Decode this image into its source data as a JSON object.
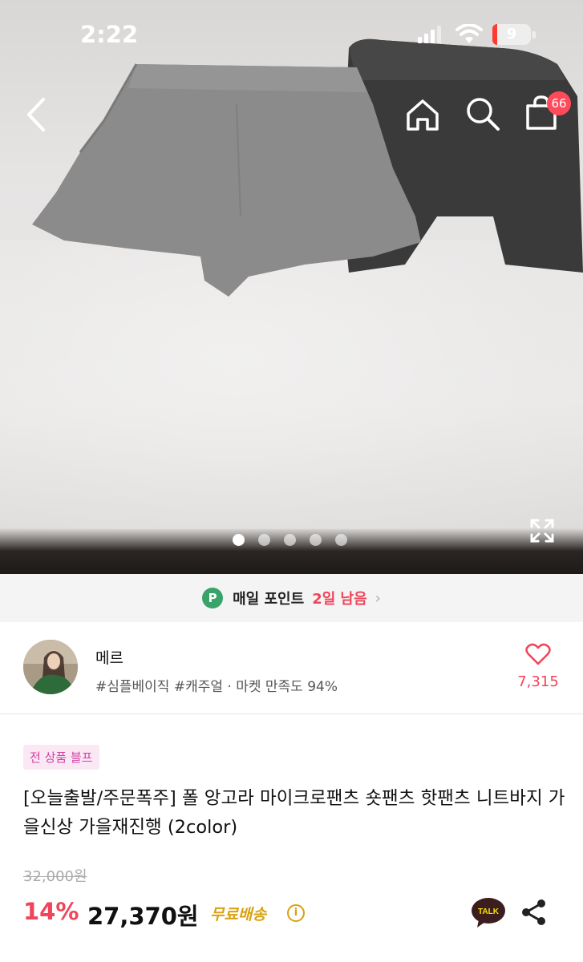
{
  "status_bar": {
    "time": "2:22",
    "battery": "9"
  },
  "header": {
    "cart_count": "66"
  },
  "gallery": {
    "total_images": 5,
    "current_index": 1
  },
  "points_banner": {
    "icon_letter": "P",
    "label": "매일 포인트",
    "remaining": "2일 남음"
  },
  "shop": {
    "name": "메르",
    "meta": "#심플베이직 #캐주얼 · 마켓 만족도 94%",
    "like_count": "7,315"
  },
  "product": {
    "sale_badge": "전 상품 블프",
    "title": "[오늘출발/주문폭주] 폴 앙고라 마이크로팬츠 숏팬츠 핫팬츠 니트바지 가을신상 가을재진행 (2color)",
    "original_price": "32,000원",
    "discount": "14%",
    "price": "27,370원",
    "shipping": "무료배송",
    "info_icon": "i",
    "talk_label": "TALK"
  },
  "colors": {
    "accent": "#f0445a",
    "points_green": "#3aa36a",
    "shipping_gold": "#d9a10f",
    "sale_badge_text": "#d23fa1"
  }
}
